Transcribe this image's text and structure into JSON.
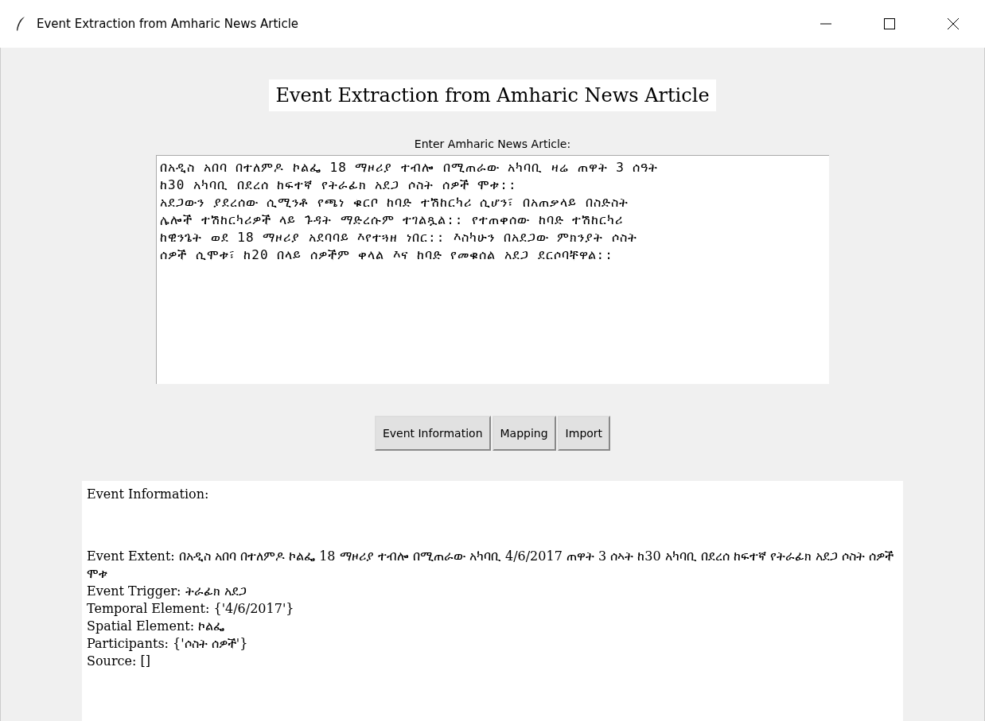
{
  "window": {
    "title": "Event Extraction from Amharic News Article"
  },
  "heading": "Event Extraction from Amharic News Article",
  "article": {
    "label": "Enter Amharic News Article:",
    "lines": [
      "በአዲስ አበባ በተለምዶ ኮልፌ 18 ማዞሪያ ተብሎ በሚጠራው አካባቢ ዛሬ ጠዋት 3 ሰዓት",
      "ከ30 አካባቢ በደረሰ ከፍተኛ የትራፊክ አደጋ ሶስት ሰዎች ሞቱ::",
      "አደጋውን ያደረሰው ሲሚንቶ የጫነ ቁርቦ ከባድ ተሽከርካሪ ሲሆን፣ በአጠቃላይ በስድስት",
      "ሌሎች ተሽከርካሪዎች ላይ ጉዳት ማድረሱም ተገልጿል:: የተጠቀሰው ከባድ ተሽከርካሪ",
      "ከዊንጌት ወደ 18 ማዞሪያ አደባባይ እየተጓዘ ነበር:: እስካሁን በአደጋው ምክንያት ሶስት",
      "ሰዎች ሲሞቱ፣ ከ20 በላይ ሰዎችም ቀላል እና ከባድ የመቁሰል አደጋ ደርሶባቸዋል::"
    ]
  },
  "buttons": [
    "Event Information",
    "Mapping",
    "Import"
  ],
  "output": {
    "title": "Event Information:",
    "lines": [
      "Event Extent: በአዲስ አበባ በተለምዶ ኮልፌ 18 ማዞሪያ ተብሎ በሚጠራው አካባቢ 4/6/2017 ጠዋት 3 ሰኣት ከ30 አካባቢ በደረሰ ከፍተኛ የትራፊክ አደጋ ሶስት ሰዎች ሞቱ",
      "Event Trigger: ትራፊክ አደጋ",
      "Temporal Element: {'4/6/2017'}",
      "Spatial Element: ኮልፌ",
      "Participants: {'ሶስት ሰዎች'}",
      "Source: []"
    ]
  }
}
